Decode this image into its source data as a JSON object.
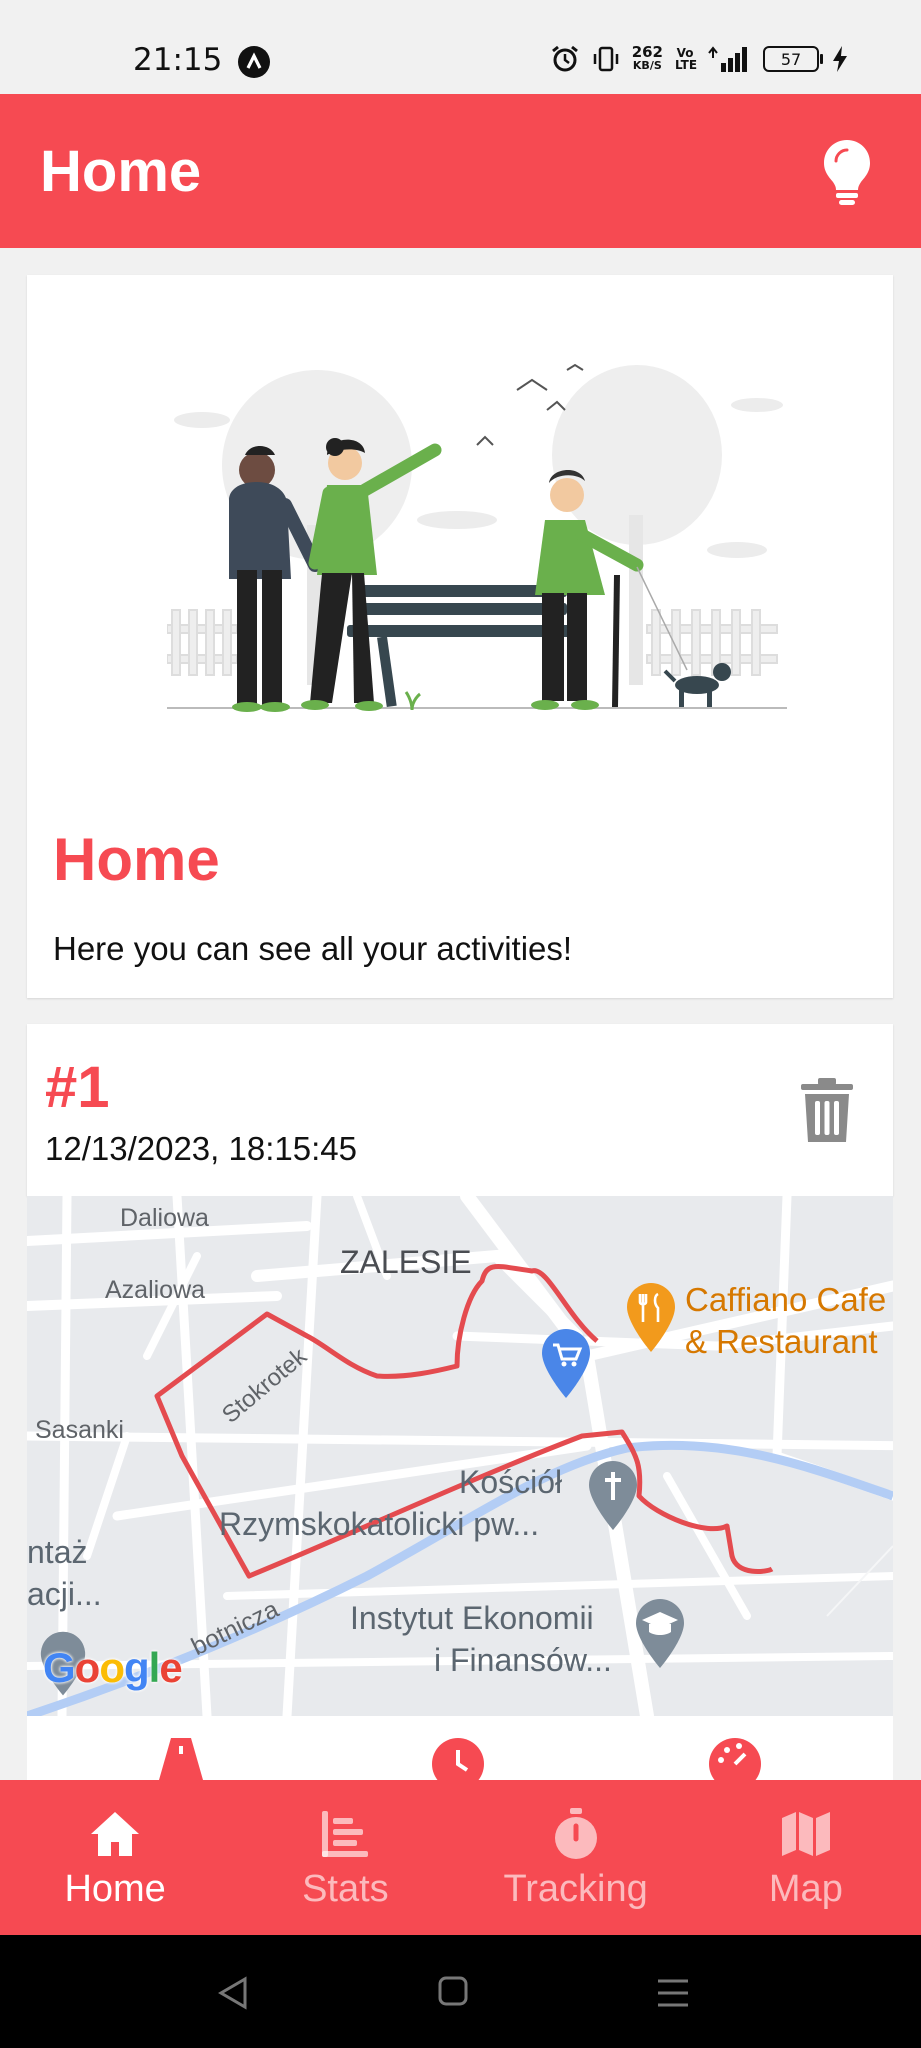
{
  "status": {
    "time": "21:15",
    "net_speed": "262",
    "net_unit": "KB/S",
    "volte": "Vo LTE",
    "battery": "57"
  },
  "appbar": {
    "title": "Home"
  },
  "hero": {
    "title": "Home",
    "subtitle": "Here you can see all your activities!"
  },
  "activity": {
    "number": "#1",
    "date": "12/13/2023, 18:15:45"
  },
  "map": {
    "labels": {
      "daliowa": "Daliowa",
      "azaliowa": "Azaliowa",
      "zalesie": "ZALESIE",
      "sasanki": "Sasanki",
      "stokrotek": "Stokrotek",
      "kosciol1": "Kościół",
      "kosciol2": "Rzymskokatolicki pw...",
      "instytut1": "Instytut Ekonomii",
      "instytut2": "i Finansów...",
      "caffiano1": "Caffiano Cafe",
      "caffiano2": "& Restaurant",
      "left1": "ntaż",
      "left2": "acji...",
      "street": "botnicza",
      "brand": "Google"
    },
    "route_color": "#e44b4f"
  },
  "nav": {
    "items": [
      {
        "label": "Home",
        "icon": "home-icon",
        "active": true
      },
      {
        "label": "Stats",
        "icon": "stats-icon",
        "active": false
      },
      {
        "label": "Tracking",
        "icon": "stopwatch-icon",
        "active": false
      },
      {
        "label": "Map",
        "icon": "map-icon",
        "active": false
      }
    ]
  },
  "colors": {
    "accent": "#f64a52",
    "grey_icon": "#8a8a8a"
  }
}
